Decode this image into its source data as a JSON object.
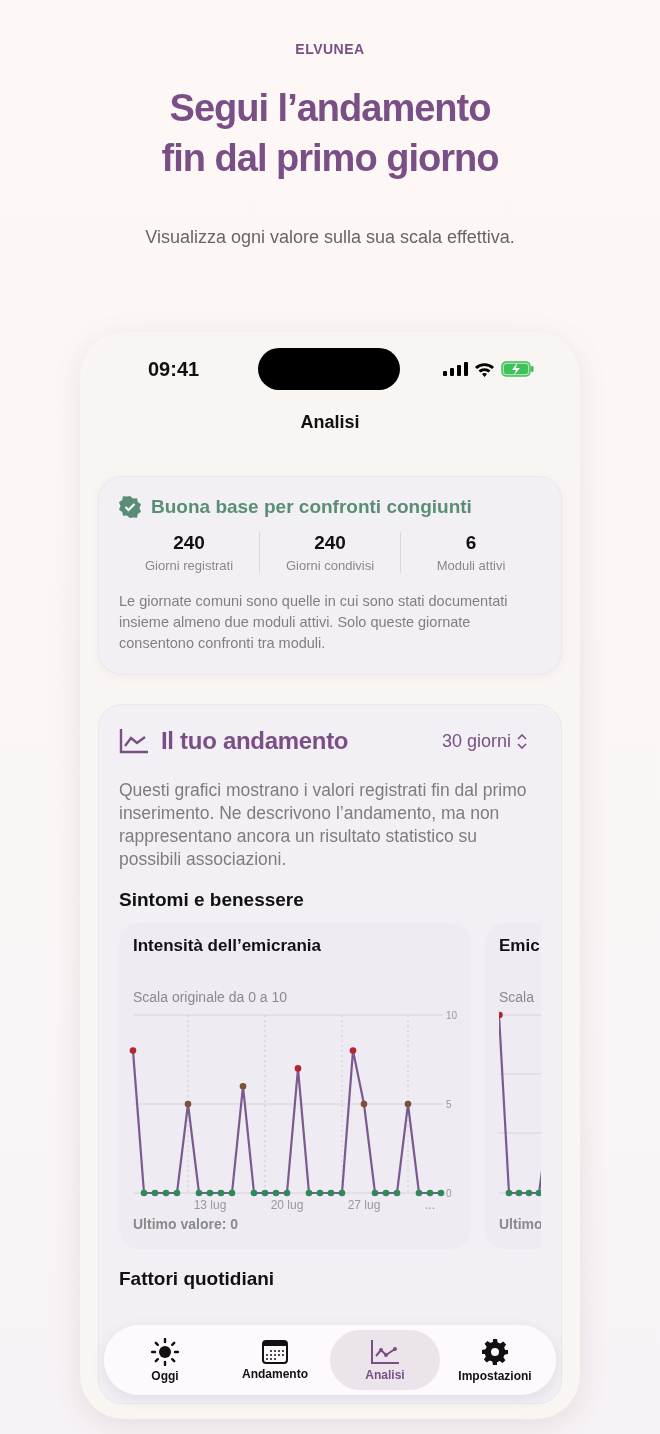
{
  "brand": "ELVUNEA",
  "headline": "Segui l’andamento\nfin dal primo giorno",
  "subtitle": "Visualizza ogni valore sulla sua scala effettiva.",
  "status_bar": {
    "time": "09:41"
  },
  "screen_title": "Analisi",
  "summary": {
    "title": "Buona base per confronti congiunti",
    "stats": [
      {
        "value": "240",
        "label": "Giorni registrati"
      },
      {
        "value": "240",
        "label": "Giorni condivisi"
      },
      {
        "value": "6",
        "label": "Moduli attivi"
      }
    ],
    "note": "Le giornate comuni sono quelle in cui sono stati documentati insieme almeno due moduli attivi. Solo queste giornate consentono confronti tra moduli."
  },
  "trend": {
    "title": "Il tuo andamento",
    "period": "30 giorni",
    "description": "Questi grafici mostrano i valori registrati fin dal primo inserimento. Ne descrivono l’andamento, ma non rappresentano ancora un risultato statistico su possibili associazioni.",
    "section": "Sintomi e benessere",
    "charts": [
      {
        "kind": "full",
        "title": "Intensità dell’emicrania",
        "scale": "Scala originale da 0 a 10",
        "chart_data": {
          "type": "line",
          "categories": [
            null,
            null,
            null,
            null,
            null,
            null,
            null,
            "13 lug",
            null,
            null,
            null,
            null,
            null,
            null,
            "20 lug",
            null,
            null,
            null,
            null,
            null,
            null,
            "27 lug",
            null,
            null,
            null,
            null,
            null,
            "...",
            null
          ],
          "series": [
            {
              "color": "#7a5a8f",
              "marker": true,
              "values": [
                8,
                0,
                0,
                0,
                0,
                5,
                0,
                0,
                0,
                0,
                6,
                0,
                0,
                0,
                0,
                7,
                0,
                0,
                0,
                0,
                8,
                5,
                0,
                0,
                0,
                5,
                0,
                0,
                0
              ]
            }
          ],
          "ylim": [
            0,
            10
          ],
          "yticks": [
            0,
            5,
            10
          ],
          "grid": true,
          "marker": true,
          "ref_lines": [
            {
              "axis": "y",
              "value": 5
            }
          ]
        },
        "last_value": "Ultimo valore: 0"
      },
      {
        "kind": "partial",
        "title": "Emic",
        "scale": "Scala",
        "last_value": "Ultimo"
      }
    ],
    "next_section": "Fattori quotidiani"
  },
  "tabs": [
    {
      "label": "Oggi",
      "selected": false
    },
    {
      "label": "Andamento",
      "selected": false
    },
    {
      "label": "Analisi",
      "selected": true
    },
    {
      "label": "Impostazioni",
      "selected": false
    }
  ]
}
